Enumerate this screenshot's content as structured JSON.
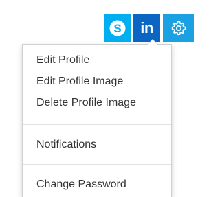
{
  "header": {
    "social": [
      {
        "name": "skype",
        "color": "#00aff0",
        "icon": "skype-icon"
      },
      {
        "name": "linkedin",
        "color": "#0a66c2",
        "icon": "linkedin-icon",
        "label": "in"
      },
      {
        "name": "settings",
        "color": "#1ba1e2",
        "icon": "gear-icon"
      }
    ]
  },
  "menu": {
    "groups": [
      {
        "items": [
          "Edit Profile",
          "Edit Profile Image",
          "Delete Profile Image"
        ]
      },
      {
        "items": [
          "Notifications"
        ]
      },
      {
        "items": [
          "Change Password"
        ]
      }
    ]
  }
}
